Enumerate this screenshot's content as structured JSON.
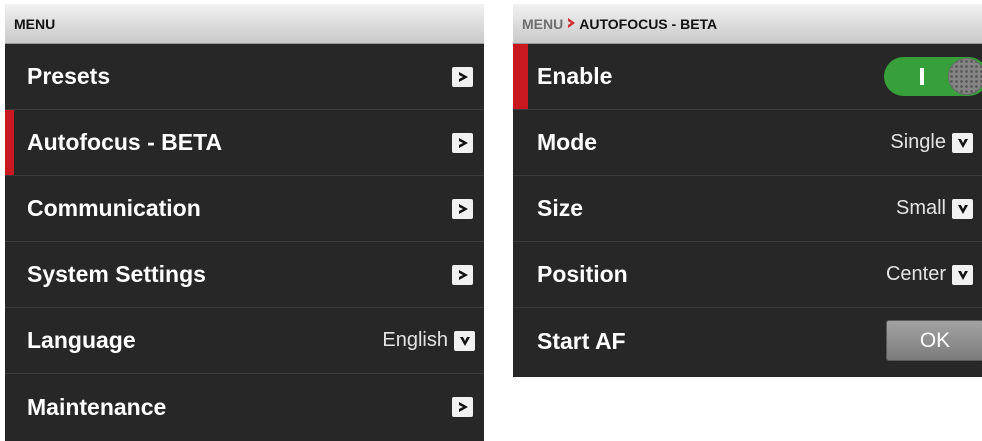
{
  "left_panel": {
    "header": "MENU",
    "items": [
      {
        "label": "Presets"
      },
      {
        "label": "Autofocus - BETA"
      },
      {
        "label": "Communication"
      },
      {
        "label": "System Settings"
      },
      {
        "label": "Language",
        "value": "English"
      },
      {
        "label": "Maintenance"
      }
    ],
    "selected_item": "Autofocus - BETA"
  },
  "right_panel": {
    "breadcrumb": {
      "root": "MENU",
      "separator": "›",
      "current": "AUTOFOCUS - BETA"
    },
    "items": [
      {
        "label": "Enable",
        "toggle_state": "on"
      },
      {
        "label": "Mode",
        "value": "Single"
      },
      {
        "label": "Size",
        "value": "Small"
      },
      {
        "label": "Position",
        "value": "Center"
      },
      {
        "label": "Start AF",
        "button_label": "OK"
      }
    ],
    "selected_item": "Enable"
  },
  "colors": {
    "panel_bg": "#272727",
    "selection_accent": "#c7191f",
    "toggle_on": "#37a03a",
    "header_bg": "#e0e0e0"
  },
  "icons": {
    "submenu": "chevron-right-icon",
    "dropdown": "chevron-down-icon"
  }
}
